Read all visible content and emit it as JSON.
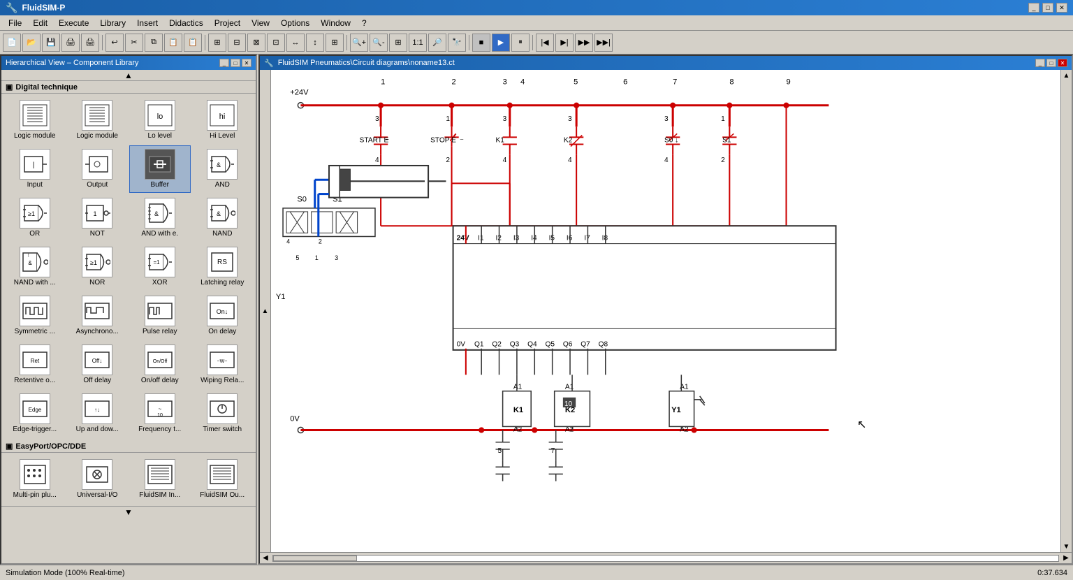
{
  "app": {
    "title": "FluidSIM-P",
    "window_title": "FluidSIM Pneumatics\\Circuit diagrams\\noname13.ct"
  },
  "menu": {
    "items": [
      "File",
      "Edit",
      "Execute",
      "Library",
      "Insert",
      "Didactics",
      "Project",
      "View",
      "Options",
      "Window",
      "?"
    ]
  },
  "toolbar": {
    "play_label": "▶",
    "stop_label": "■",
    "pause_label": "⏸",
    "step_back_label": "|◀",
    "step_label": "▶|",
    "step_fwd_label": "▶▶",
    "fast_fwd_label": "▶▶|"
  },
  "library": {
    "title": "Hierarchical View – Component Library",
    "section_digital": "Digital technique",
    "section_easyport": "EasyPort/OPC/DDE",
    "components": [
      {
        "id": "logic-module-1",
        "label": "Logic module",
        "type": "logic1"
      },
      {
        "id": "logic-module-2",
        "label": "Logic module",
        "type": "logic2"
      },
      {
        "id": "lo-level",
        "label": "Lo level",
        "type": "lo"
      },
      {
        "id": "hi-level",
        "label": "Hi Level",
        "type": "hi"
      },
      {
        "id": "input",
        "label": "Input",
        "type": "input"
      },
      {
        "id": "output",
        "label": "Output",
        "type": "output"
      },
      {
        "id": "buffer",
        "label": "Buffer",
        "type": "buffer",
        "selected": true
      },
      {
        "id": "and",
        "label": "AND",
        "type": "and"
      },
      {
        "id": "or",
        "label": "OR",
        "type": "or"
      },
      {
        "id": "not",
        "label": "NOT",
        "type": "not"
      },
      {
        "id": "and-with-e",
        "label": "AND with e.",
        "type": "and-e"
      },
      {
        "id": "nand",
        "label": "NAND",
        "type": "nand"
      },
      {
        "id": "nand-with",
        "label": "NAND with ...",
        "type": "nand-w"
      },
      {
        "id": "nor",
        "label": "NOR",
        "type": "nor"
      },
      {
        "id": "xor",
        "label": "XOR",
        "type": "xor"
      },
      {
        "id": "latching",
        "label": "Latching relay",
        "type": "latching"
      },
      {
        "id": "symmetric",
        "label": "Symmetric ...",
        "type": "sym"
      },
      {
        "id": "asynchrono",
        "label": "Asynchrono...",
        "type": "async"
      },
      {
        "id": "pulse-relay",
        "label": "Pulse relay",
        "type": "pulse"
      },
      {
        "id": "on-delay",
        "label": "On delay",
        "type": "on-delay"
      },
      {
        "id": "retentive",
        "label": "Retentive o...",
        "type": "retentive"
      },
      {
        "id": "off-delay",
        "label": "Off delay",
        "type": "off-delay"
      },
      {
        "id": "on-off-delay",
        "label": "On/off delay",
        "type": "on-off"
      },
      {
        "id": "wiping-rela",
        "label": "Wiping Rela...",
        "type": "wiping"
      },
      {
        "id": "edge-trigger",
        "label": "Edge-trigger...",
        "type": "edge"
      },
      {
        "id": "up-and-dow",
        "label": "Up and dow...",
        "type": "up-down"
      },
      {
        "id": "frequency-t",
        "label": "Frequency t...",
        "type": "freq"
      },
      {
        "id": "timer-switch",
        "label": "Timer switch",
        "type": "timer"
      }
    ],
    "easyport_components": [
      {
        "id": "multi-pin",
        "label": "Multi-pin plu...",
        "type": "multi-pin"
      },
      {
        "id": "universal-io",
        "label": "Universal-I/O",
        "type": "univ-io"
      },
      {
        "id": "fluidsim-in",
        "label": "FluidSIM In...",
        "type": "fsim-in"
      },
      {
        "id": "fluidsim-out",
        "label": "FluidSIM Ou...",
        "type": "fsim-out"
      }
    ]
  },
  "diagram": {
    "nodes": {
      "plus24v": "+24V",
      "zero_v": "0V",
      "bus_labels": [
        "1",
        "2",
        "3",
        "4",
        "5",
        "6",
        "7",
        "8",
        "9"
      ],
      "start_label": "START E",
      "stop_label": "STOP E",
      "k1_label": "K1",
      "k2_label": "K2",
      "s0_label": "S0",
      "s1_label": "S1",
      "y1_label": "Y1",
      "k1_coil": "K1",
      "k2_coil": "K2",
      "y1_coil": "Y1",
      "plc_inputs": [
        "24V",
        "I1",
        "I2",
        "I3",
        "I4",
        "I5",
        "I6",
        "I7",
        "I8"
      ],
      "plc_outputs": [
        "0V",
        "Q1",
        "Q2",
        "Q3",
        "Q4",
        "Q5",
        "Q6",
        "Q7",
        "Q8"
      ],
      "contact_3_1": "3",
      "contact_4_1": "4",
      "contact_1_1": "1",
      "contact_2_1": "2",
      "contact_3_2": "3",
      "contact_4_2": "4",
      "contact_3_3": "3",
      "contact_4_3": "4",
      "contact_3_4": "3",
      "contact_4_4": "4",
      "contact_1_2": "1",
      "contact_2_2": "2",
      "a1_k1": "A1",
      "a2_k1": "A2",
      "a1_k2": "A1",
      "a2_k2": "A2",
      "pos_5": "5",
      "pos_7": "7",
      "k2_val": "10",
      "s0_contacts": "S0 ↓",
      "s1_contacts": "S1",
      "valve_s0_label": "S0",
      "valve_s1_label": "S1",
      "valve_pos4": "4",
      "valve_pos2": "2",
      "valve_pos5": "5",
      "valve_pos1": "1",
      "valve_pos3": "3"
    }
  },
  "status": {
    "mode": "Simulation Mode (100% Real-time)",
    "time": "0:37.634"
  },
  "colors": {
    "active_red": "#cc0000",
    "active_blue": "#0044cc",
    "wire_gray": "#666666",
    "panel_bg": "#d4d0c8",
    "selected_bg": "#a0b4cc"
  }
}
